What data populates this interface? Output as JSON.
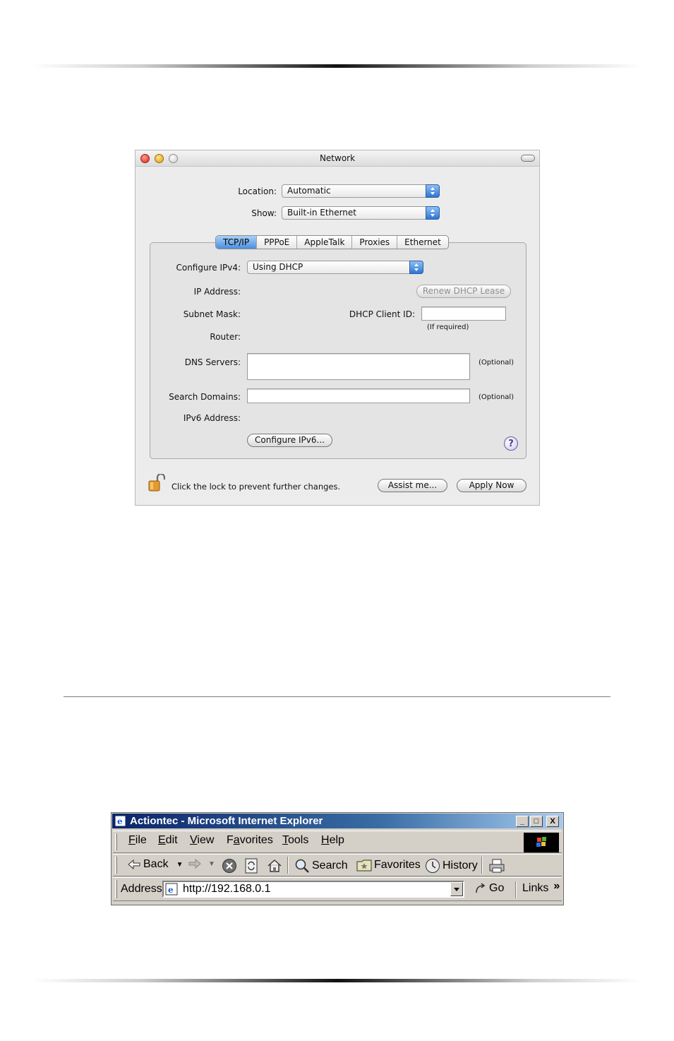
{
  "mac_window": {
    "title": "Network",
    "location_label": "Location:",
    "location_value": "Automatic",
    "show_label": "Show:",
    "show_value": "Built-in Ethernet",
    "tabs": [
      "TCP/IP",
      "PPPoE",
      "AppleTalk",
      "Proxies",
      "Ethernet"
    ],
    "active_tab": "TCP/IP",
    "configure_ipv4_label": "Configure IPv4:",
    "configure_ipv4_value": "Using DHCP",
    "ip_address_label": "IP Address:",
    "renew_button": "Renew DHCP Lease",
    "subnet_mask_label": "Subnet Mask:",
    "dhcp_client_id_label": "DHCP Client ID:",
    "dhcp_client_id_value": "",
    "if_required": "(If required)",
    "router_label": "Router:",
    "dns_servers_label": "DNS Servers:",
    "dns_servers_value": "",
    "dns_optional": "(Optional)",
    "search_domains_label": "Search Domains:",
    "search_domains_value": "",
    "search_optional": "(Optional)",
    "ipv6_address_label": "IPv6 Address:",
    "configure_ipv6_button": "Configure IPv6...",
    "help_glyph": "?",
    "lock_text": "Click the lock to prevent further changes.",
    "assist_button": "Assist me...",
    "apply_button": "Apply Now",
    "icons": [
      "close-light",
      "minimize-light",
      "zoom-light",
      "toolbar-toggle",
      "popup-arrows",
      "help-icon",
      "padlock-icon"
    ],
    "colors": {
      "accent_blue": "#4d8fe0",
      "window_bg": "#ececec"
    }
  },
  "ie_window": {
    "title": "Actiontec - Microsoft Internet Explorer",
    "title_buttons": {
      "minimize": "_",
      "maximize": "□",
      "close": "X"
    },
    "menu": [
      "File",
      "Edit",
      "View",
      "Favorites",
      "Tools",
      "Help"
    ],
    "menu_accel": [
      "F",
      "E",
      "V",
      "a",
      "T",
      "H"
    ],
    "toolbar": {
      "back": "Back",
      "search": "Search",
      "favorites": "Favorites",
      "history": "History"
    },
    "address_label": "Address",
    "address_value": "http://192.168.0.1",
    "go_label": "Go",
    "links_label": "Links",
    "links_chevron": "»",
    "icons": [
      "ie-logo-icon",
      "back-arrow-icon",
      "forward-arrow-icon",
      "stop-icon",
      "refresh-icon",
      "home-icon",
      "search-icon",
      "favorites-icon",
      "history-icon",
      "print-icon",
      "windows-logo-icon",
      "go-arrow-icon"
    ],
    "colors": {
      "title_start": "#0a246a",
      "title_end": "#a6caf0",
      "chrome": "#d4d0c8"
    }
  }
}
